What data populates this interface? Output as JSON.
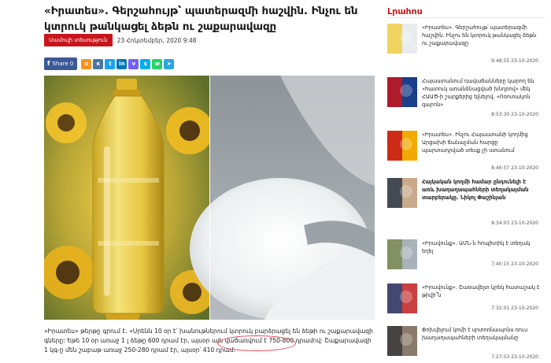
{
  "article": {
    "title_line1": "«Իրատես». Գերշահույթ՝ պատերազմի հաշվին. Ինչու են",
    "title_line2": "կտրուկ թանկացել ձեթն ու շաքարավազը",
    "category": "Սամուլի տեսություն",
    "date": "23 Հոկտեմբեր, 2020 9:48",
    "share_label": "Share 0",
    "body_part1": "«Իրատես» թերթը գրում է. «Սրենն 10 օր է՝ խանութներում կտրուկ բարձրացել են ձեթի ու շաքարավազի գները: Եթե 10 օր առաջ 1 լ ձեթը ",
    "body_highlight": "600 դրամ էր, այսօր այն վաճառվում է 750-800 դրամով",
    "body_part2": ": Շաքարավազի 1 կգ-ը մեն շաբաթ առաջ 250-280 դրամ էր, այսօր՝ 410 դրամ:"
  },
  "share_icons": [
    {
      "name": "odnoklassniki-icon",
      "glyph": "o",
      "color": "#f7931e"
    },
    {
      "name": "vk-icon",
      "glyph": "к",
      "color": "#4c75a3"
    },
    {
      "name": "twitter-icon",
      "glyph": "t",
      "color": "#1da1f2"
    },
    {
      "name": "linkedin-icon",
      "glyph": "in",
      "color": "#0077b5"
    },
    {
      "name": "viber-icon",
      "glyph": "v",
      "color": "#7360f2"
    },
    {
      "name": "skype-icon",
      "glyph": "s",
      "color": "#00aff0"
    },
    {
      "name": "whatsapp-icon",
      "glyph": "w",
      "color": "#25d366"
    },
    {
      "name": "telegram-icon",
      "glyph": "➤",
      "color": "#2ca5e0"
    }
  ],
  "sidebar": {
    "title": "Լրահոս",
    "items": [
      {
        "text": "«Իրատես». Գերշահույթ՝ պատերազմի հաշվին. Ինչու են կտրուկ թանկացել ձեթն ու շաքարավազը",
        "time": "9:48:55 23-10-2020",
        "bold": false
      },
      {
        "text": "Հայաստանում դավաճանները կարող են «հատուկ առանձնացված խնդրով» մեկ ՀԱԱԾ-ի շարքերից ելնելով. «Ոռոտակոն գարոն»",
        "time": "8:53:30 23-10-2020",
        "bold": false
      },
      {
        "text": "«Իրատես». Ինչու Հայաստանի կողմից Արցախի ճանաչման հարցը պարտադրված տեսք չի ստանում",
        "time": "8:46:57 23-10-2020",
        "bold": false
      },
      {
        "text": "Հայկական կողմի համար ընդունելի է առև խաղաղապահների տեղակայման տարբերակը. Նիկոլ Փաշինյան",
        "time": "8:34:03 23-10-2020",
        "bold": true
      },
      {
        "text": "«Իրավունք». ԱՄՆ-ն հոպիտիկ է տեղակ եղել",
        "time": "7:40:15 23-10-2020",
        "bold": false
      },
      {
        "text": "«Իրավունք». Շառավելտ կրեկ հատաշակ է թիվի՞ն",
        "time": "7:32:01 23-10-2020",
        "bold": false
      },
      {
        "text": "Փոխվելում կոմի է սրտոռնապոնս ռուս խաղաղապահների տեղակայմանը",
        "time": "7:27:53 23-10-2020",
        "bold": false
      }
    ]
  }
}
